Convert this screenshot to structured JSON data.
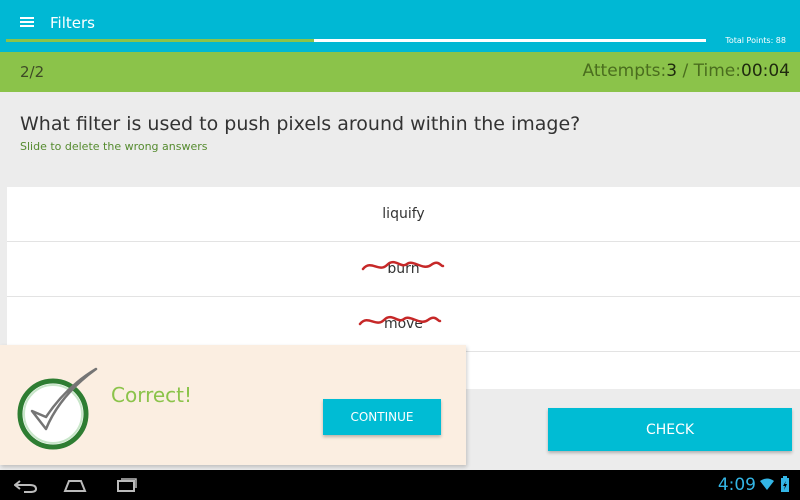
{
  "app": {
    "title": "Filters",
    "total_points": "Total Points: 88",
    "progress_fraction": 0.44
  },
  "status": {
    "page": "2/2",
    "attempts_label": "Attempts:",
    "attempts_value": "3",
    "separator": " / ",
    "time_label": "Time:",
    "time_value": "00:04"
  },
  "question": {
    "text": "What filter is used to push pixels around within the image?",
    "hint": "Slide to delete the wrong answers"
  },
  "answers": [
    {
      "label": "liquify",
      "struck": false
    },
    {
      "label": "burn",
      "struck": true
    },
    {
      "label": "move",
      "struck": true
    },
    {
      "label": "",
      "struck": false
    }
  ],
  "buttons": {
    "check": "CHECK",
    "continue": "CONTINUE"
  },
  "feedback": {
    "message": "Correct!"
  },
  "system": {
    "clock": "4:09"
  },
  "colors": {
    "appbar": "#00b8d4",
    "statusbar": "#8bc34a",
    "accent": "#00bcd4",
    "correct": "#8bc34a",
    "strike": "#c62828"
  },
  "icons": [
    "menu-icon",
    "checkmark-icon",
    "back-icon",
    "home-icon",
    "recents-icon",
    "wifi-icon",
    "battery-icon"
  ]
}
